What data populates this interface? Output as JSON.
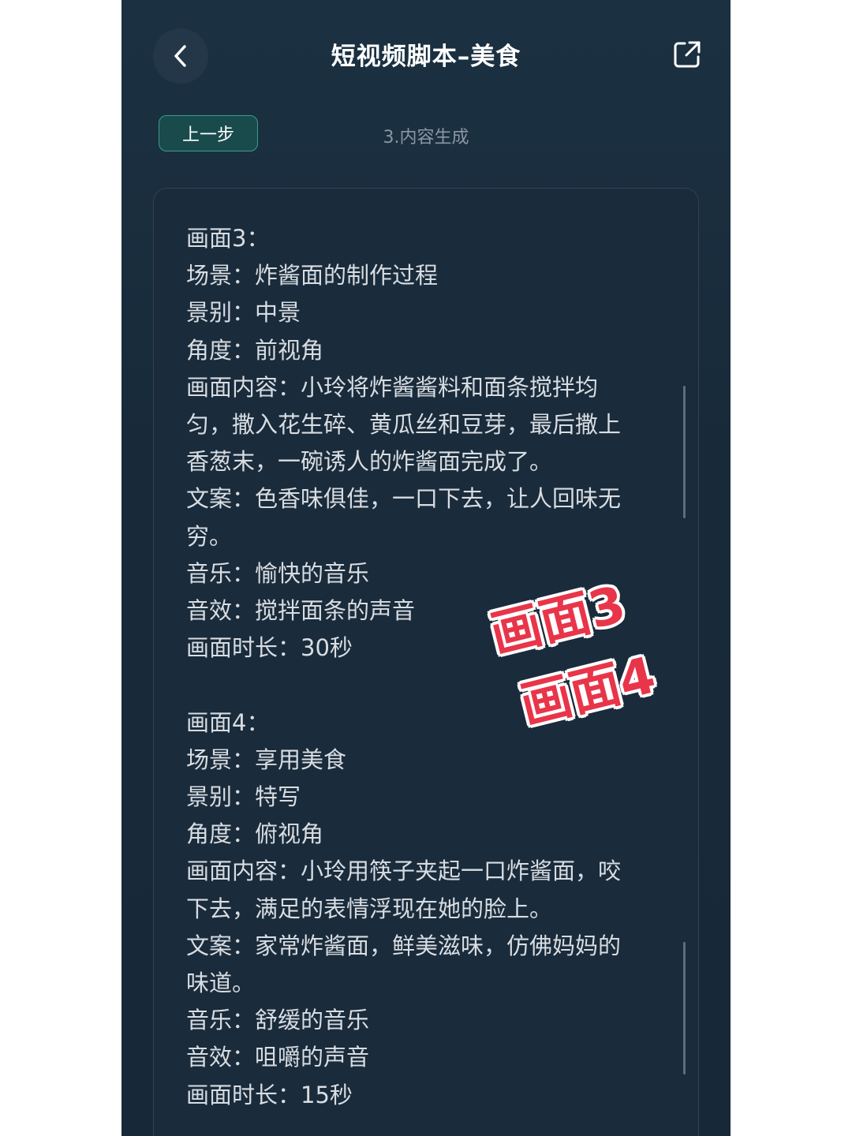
{
  "header": {
    "title": "短视频脚本–美食",
    "back_icon": "chevron-left-icon",
    "share_icon": "external-share-icon"
  },
  "toolbar": {
    "prev_label": "上一步",
    "step_label": "3.内容生成"
  },
  "scenes": [
    {
      "heading": "画面3：",
      "scene": "场景：炸酱面的制作过程",
      "shot": "景别：中景",
      "angle": "角度：前视角",
      "content_1": "画面内容：小玲将炸酱酱料和面条搅拌均",
      "content_2": "匀，撒入花生碎、黄瓜丝和豆芽，最后撒上",
      "content_3": "香葱末，一碗诱人的炸酱面完成了。",
      "copy_1": "文案：色香味俱佳，一口下去，让人回味无",
      "copy_2": "穷。",
      "music": "音乐：愉快的音乐",
      "sfx": "音效：搅拌面条的声音",
      "duration": "画面时长：30秒"
    },
    {
      "heading": "画面4：",
      "scene": "场景：享用美食",
      "shot": "景别：特写",
      "angle": "角度：俯视角",
      "content_1": "画面内容：小玲用筷子夹起一口炸酱面，咬",
      "content_2": "下去，满足的表情浮现在她的脸上。",
      "copy_1": "文案：家常炸酱面，鲜美滋味，仿佛妈妈的",
      "copy_2": "味道。",
      "music": "音乐：舒缓的音乐",
      "sfx": "音效：咀嚼的声音",
      "duration": "画面时长：15秒"
    }
  ],
  "stickers": {
    "line1": "画面3",
    "line2": "画面4",
    "color": "#e8354a"
  },
  "colors": {
    "background": "#182a3a",
    "accent_border": "#3a9c8a",
    "accent_fill": "#1a4b4c"
  }
}
